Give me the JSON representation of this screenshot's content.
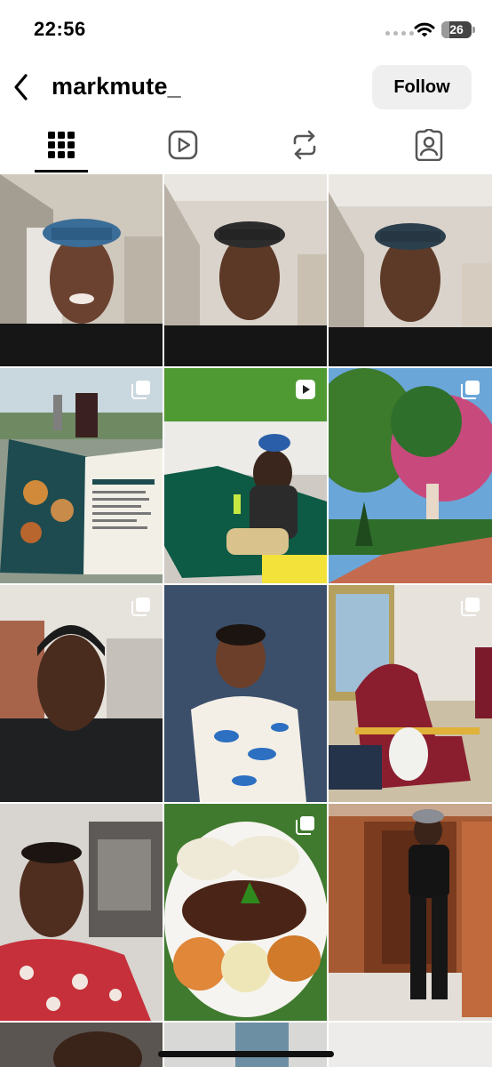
{
  "status_bar": {
    "time": "22:56",
    "battery": "26",
    "battery_level": 0.26,
    "icons": [
      "signal-icon",
      "wifi-icon",
      "battery-icon"
    ]
  },
  "header": {
    "username": "markmute_",
    "follow_label": "Follow",
    "back_icon": "chevron-left-icon"
  },
  "tabs": [
    {
      "name": "tab-posts",
      "icon": "grid-icon",
      "active": true
    },
    {
      "name": "tab-reels",
      "icon": "play-icon",
      "active": false
    },
    {
      "name": "tab-reposts",
      "icon": "repost-icon",
      "active": false
    },
    {
      "name": "tab-tagged",
      "icon": "person-tag-icon",
      "active": false
    }
  ],
  "posts": [
    {
      "name": "post-selfie-cap-1",
      "badge": "none",
      "subject": "man in blue cap and black t-shirt"
    },
    {
      "name": "post-selfie-cap-2",
      "badge": "none",
      "subject": "man in blue cap and black t-shirt"
    },
    {
      "name": "post-selfie-cap-3",
      "badge": "none",
      "subject": "man in blue cap and black t-shirt"
    },
    {
      "name": "post-menu",
      "badge": "carousel-icon",
      "subject": "restaurant menu"
    },
    {
      "name": "post-sofa",
      "badge": "reel-icon",
      "subject": "man on green sofa"
    },
    {
      "name": "post-garden",
      "badge": "carousel-icon",
      "subject": "garden with pink flowers"
    },
    {
      "name": "post-portrait",
      "badge": "carousel-icon",
      "subject": "man in black jacket"
    },
    {
      "name": "post-child",
      "badge": "none",
      "subject": "child in dinosaur shirt"
    },
    {
      "name": "post-chairs",
      "badge": "carousel-icon",
      "subject": "red chairs"
    },
    {
      "name": "post-car-selfie",
      "badge": "none",
      "subject": "man in red shirt in car"
    },
    {
      "name": "post-food",
      "badge": "carousel-icon",
      "subject": "plate of food"
    },
    {
      "name": "post-full-body",
      "badge": "none",
      "subject": "man in black outfit"
    }
  ],
  "colors": {
    "follow_bg": "#efefef",
    "text": "#000000"
  }
}
